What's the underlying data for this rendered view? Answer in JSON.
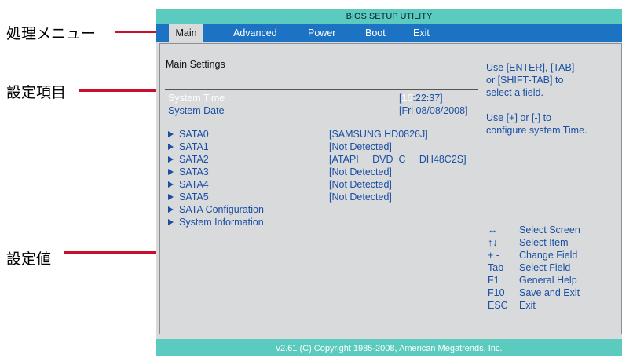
{
  "callouts": {
    "menu": "処理メニュー",
    "items": "設定項目",
    "values": "設定値"
  },
  "bios": {
    "title": "BIOS SETUP UTILITY",
    "menu": [
      "Main",
      "Advanced",
      "Power",
      "Boot",
      "Exit"
    ],
    "active_menu": "Main",
    "section_title": "Main  Settings",
    "system_time": {
      "label": "System  Time",
      "value_prefix": "[",
      "value_hour": "16",
      "value_rest": ":22:37]"
    },
    "system_date": {
      "label": "System  Date",
      "value": "[Fri  08/08/2008]"
    },
    "submenus": [
      {
        "label": "SATA0",
        "value": "[SAMSUNG  HD0826J]"
      },
      {
        "label": "SATA1",
        "value": "[Not  Detected]"
      },
      {
        "label": "SATA2",
        "value": "[ATAPI     DVD  C     DH48C2S]"
      },
      {
        "label": "SATA3",
        "value": "[Not  Detected]"
      },
      {
        "label": "SATA4",
        "value": "[Not  Detected]"
      },
      {
        "label": "SATA5",
        "value": "[Not  Detected]"
      },
      {
        "label": "SATA  Configuration",
        "value": ""
      },
      {
        "label": "System Information",
        "value": ""
      }
    ],
    "help_text": [
      "Use [ENTER], [TAB]",
      "or [SHIFT-TAB] to",
      "select a field.",
      "",
      "Use [+] or [-] to",
      "configure system Time."
    ],
    "keys": [
      {
        "key": "↔",
        "desc": "Select Screen"
      },
      {
        "key": "↑↓",
        "desc": "Select Item"
      },
      {
        "key": "+ -",
        "desc": "Change Field"
      },
      {
        "key": "Tab",
        "desc": "Select Field"
      },
      {
        "key": "F1",
        "desc": "General Help"
      },
      {
        "key": "F10",
        "desc": "Save and Exit"
      },
      {
        "key": "ESC",
        "desc": "Exit"
      }
    ],
    "copyright": "v2.61 (C) Copyright  1985-2008, American Megatrends, Inc."
  },
  "colors": {
    "title_bar": "#5ccbbf",
    "menu_bar": "#1c73c4",
    "panel": "#d8dadc",
    "text": "#1a4fa3",
    "callout_line": "#c8102e"
  }
}
